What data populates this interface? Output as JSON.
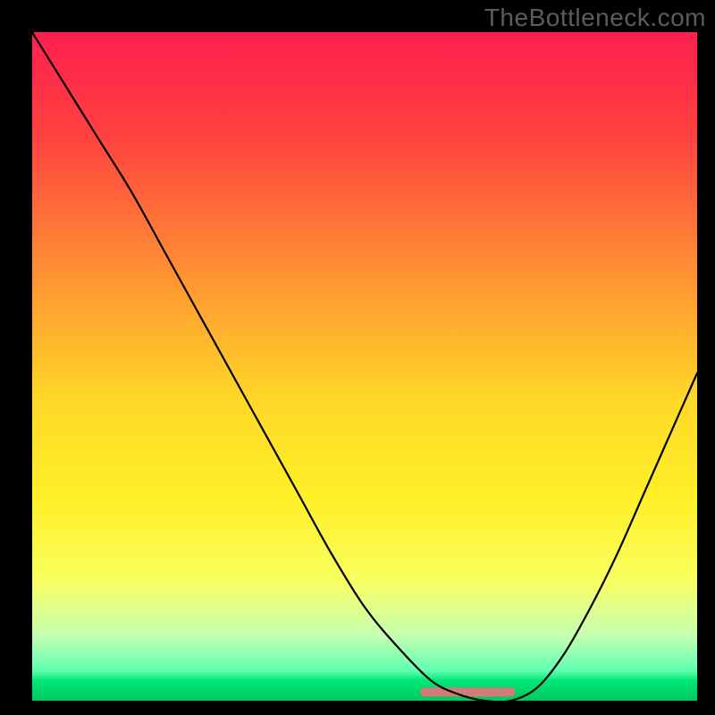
{
  "watermark": "TheBottleneck.com",
  "chart_data": {
    "type": "line",
    "title": "",
    "xlabel": "",
    "ylabel": "",
    "xlim": [
      0,
      100
    ],
    "ylim": [
      0,
      100
    ],
    "background_gradient": {
      "stops": [
        {
          "offset": 0.0,
          "color": "#ff1f4f"
        },
        {
          "offset": 0.15,
          "color": "#ff4040"
        },
        {
          "offset": 0.4,
          "color": "#ffa030"
        },
        {
          "offset": 0.55,
          "color": "#ffd828"
        },
        {
          "offset": 0.7,
          "color": "#fff028"
        },
        {
          "offset": 0.82,
          "color": "#f8ff60"
        },
        {
          "offset": 0.9,
          "color": "#c8ffb0"
        },
        {
          "offset": 0.955,
          "color": "#60ffb0"
        },
        {
          "offset": 0.97,
          "color": "#00e878"
        },
        {
          "offset": 1.0,
          "color": "#00c860"
        }
      ]
    },
    "series": [
      {
        "name": "bottleneck-curve",
        "color": "#000000",
        "x": [
          0,
          5,
          10,
          15,
          20,
          25,
          30,
          35,
          40,
          45,
          50,
          55,
          60,
          64,
          68,
          72,
          76,
          80,
          84,
          88,
          92,
          96,
          100
        ],
        "y": [
          100,
          92,
          84,
          76,
          67,
          58,
          49,
          40,
          31,
          22,
          14,
          8,
          3,
          1,
          0,
          0,
          2,
          7,
          14,
          22,
          31,
          40,
          49
        ]
      }
    ],
    "flat_segment": {
      "x_start": 59,
      "x_end": 72,
      "y": 1.3,
      "color": "#d47a78"
    }
  }
}
